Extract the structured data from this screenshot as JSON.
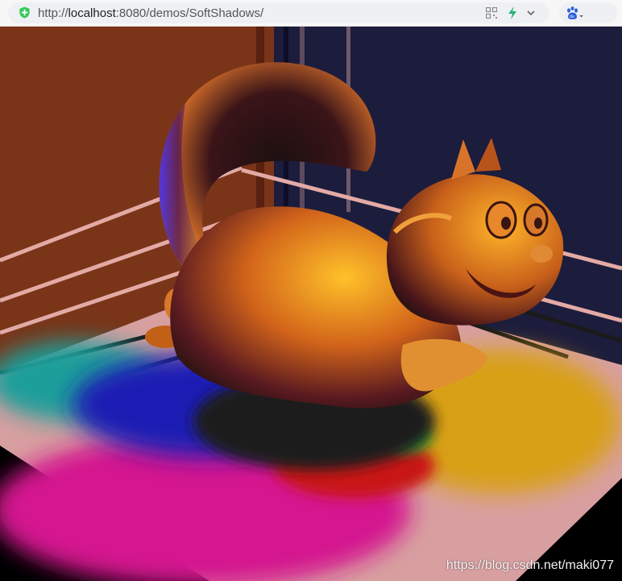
{
  "browser": {
    "url_prefix": "http://",
    "url_host": "localhost",
    "url_rest": ":8080/demos/SoftShadows/",
    "icons": {
      "secure": "shield-plus-icon",
      "qr": "qr-code-icon",
      "bolt": "lightning-icon",
      "dropdown": "chevron-down-icon",
      "search_engine": "baidu-paw-icon"
    }
  },
  "scene": {
    "description_key": "soft-shadows-demo",
    "colors": {
      "left_wall": "#7a3418",
      "back_wall": "#1c1c3c",
      "floor": "#d89fa0",
      "shadow_teal": "#1a9e9a",
      "shadow_blue": "#1e1ab4",
      "shadow_magenta": "#d4188f",
      "shadow_red": "#c81818",
      "shadow_yellow": "#d8a018",
      "shadow_green": "#2ab83a",
      "shadow_core": "#1a1a1a",
      "squirrel_light": "#ffb020",
      "squirrel_mid": "#c85a10",
      "squirrel_dark": "#1c1010",
      "squirrel_rim_blue": "#3a2aff"
    }
  },
  "watermark": "https://blog.csdn.net/maki077"
}
